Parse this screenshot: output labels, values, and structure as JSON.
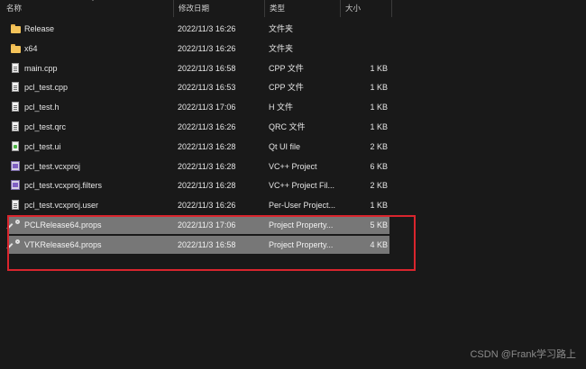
{
  "columns": {
    "name": "名称",
    "date": "修改日期",
    "type": "类型",
    "size": "大小"
  },
  "files": [
    {
      "name": "Release",
      "date": "2022/11/3 16:26",
      "type": "文件夹",
      "size": "",
      "icon": "folder-icon",
      "selected": false
    },
    {
      "name": "x64",
      "date": "2022/11/3 16:26",
      "type": "文件夹",
      "size": "",
      "icon": "folder-icon",
      "selected": false
    },
    {
      "name": "main.cpp",
      "date": "2022/11/3 16:58",
      "type": "CPP 文件",
      "size": "1 KB",
      "icon": "document-icon",
      "selected": false
    },
    {
      "name": "pcl_test.cpp",
      "date": "2022/11/3 16:53",
      "type": "CPP 文件",
      "size": "1 KB",
      "icon": "document-icon",
      "selected": false
    },
    {
      "name": "pcl_test.h",
      "date": "2022/11/3 17:06",
      "type": "H 文件",
      "size": "1 KB",
      "icon": "document-icon",
      "selected": false
    },
    {
      "name": "pcl_test.qrc",
      "date": "2022/11/3 16:26",
      "type": "QRC 文件",
      "size": "1 KB",
      "icon": "document-icon",
      "selected": false
    },
    {
      "name": "pcl_test.ui",
      "date": "2022/11/3 16:28",
      "type": "Qt UI file",
      "size": "2 KB",
      "icon": "qt-ui-file-icon",
      "selected": false
    },
    {
      "name": "pcl_test.vcxproj",
      "date": "2022/11/3 16:28",
      "type": "VC++ Project",
      "size": "6 KB",
      "icon": "vcxproj-icon",
      "selected": false
    },
    {
      "name": "pcl_test.vcxproj.filters",
      "date": "2022/11/3 16:28",
      "type": "VC++ Project Fil...",
      "size": "2 KB",
      "icon": "vcxproj-filters-icon",
      "selected": false
    },
    {
      "name": "pcl_test.vcxproj.user",
      "date": "2022/11/3 16:26",
      "type": "Per-User Project...",
      "size": "1 KB",
      "icon": "document-icon",
      "selected": false
    },
    {
      "name": "PCLRelease64.props",
      "date": "2022/11/3 17:06",
      "type": "Project Property...",
      "size": "5 KB",
      "icon": "property-sheet-icon",
      "selected": true
    },
    {
      "name": "VTKRelease64.props",
      "date": "2022/11/3 16:58",
      "type": "Project Property...",
      "size": "4 KB",
      "icon": "property-sheet-icon",
      "selected": true
    }
  ],
  "watermark": "CSDN @Frank学习路上",
  "colors": {
    "background": "#191919",
    "selected_row": "#777777",
    "annotation_box": "#d9252d",
    "folder": "#f4c35a"
  }
}
